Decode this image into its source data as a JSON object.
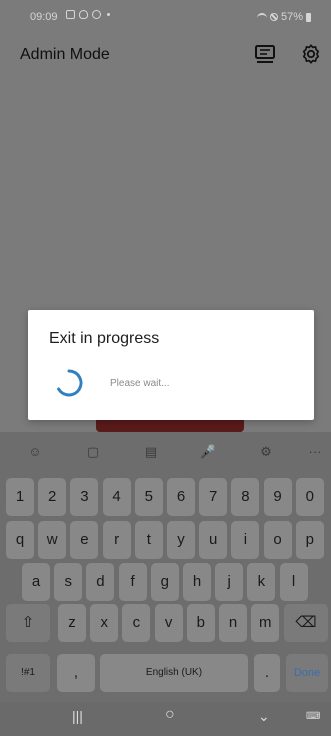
{
  "status_bar": {
    "time": "09:09",
    "battery": "57%"
  },
  "app_bar": {
    "title": "Admin Mode"
  },
  "dialog": {
    "title": "Exit in progress",
    "message": "Please wait..."
  },
  "keyboard": {
    "number_row": [
      "1",
      "2",
      "3",
      "4",
      "5",
      "6",
      "7",
      "8",
      "9",
      "0"
    ],
    "row1": [
      "q",
      "w",
      "e",
      "r",
      "t",
      "y",
      "u",
      "i",
      "o",
      "p"
    ],
    "row2": [
      "a",
      "s",
      "d",
      "f",
      "g",
      "h",
      "j",
      "k",
      "l"
    ],
    "row3": [
      "z",
      "x",
      "c",
      "v",
      "b",
      "n",
      "m"
    ],
    "symbols_label": "!#1",
    "comma_label": ",",
    "space_label": "English (UK)",
    "period_label": ".",
    "done_label": "Done"
  },
  "colors": {
    "spinner": "#2f7fc1",
    "done_text": "#3b6db0"
  }
}
